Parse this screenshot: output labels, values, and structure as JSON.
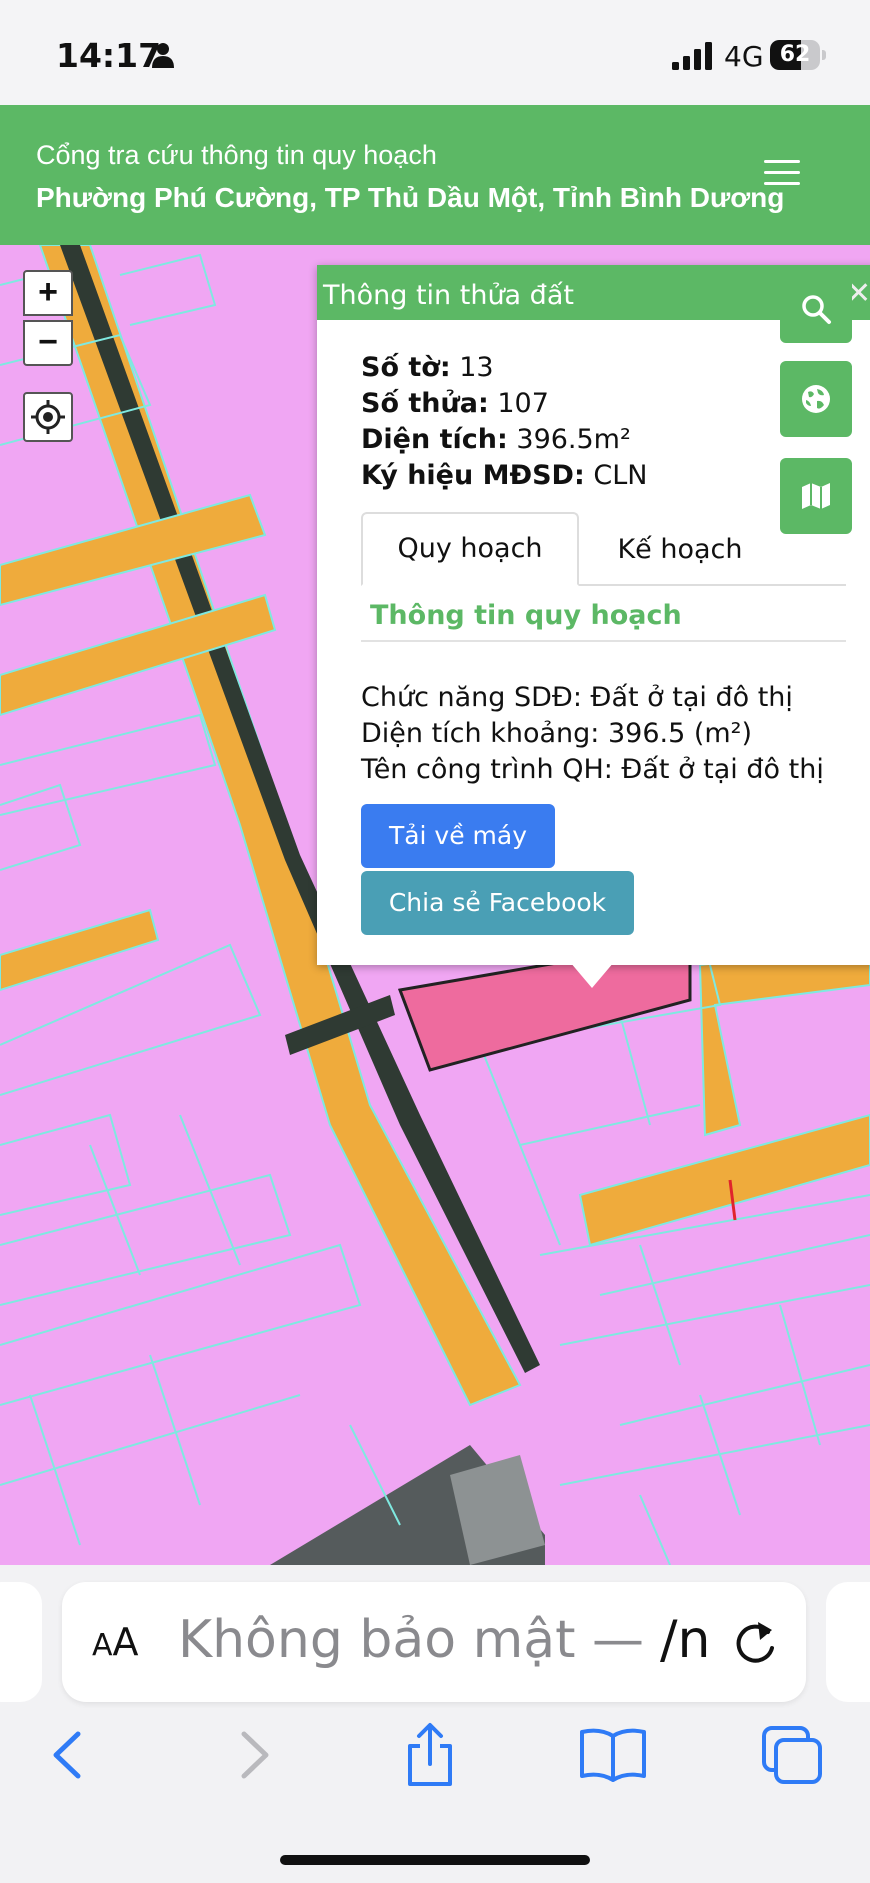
{
  "status_bar": {
    "time": "14:17",
    "network": "4G",
    "battery": "62",
    "battery_level": 0.62
  },
  "header": {
    "subtitle": "Cổng tra cứu thông tin quy hoạch",
    "title": "Phường Phú Cường, TP Thủ Dầu Một, Tỉnh Bình Dương"
  },
  "map_controls": {
    "zoom_in": "+",
    "zoom_out": "−"
  },
  "popup": {
    "title": "Thông tin thửa đất",
    "close": "✕",
    "so_to_label": "Số tờ:",
    "so_to_value": "13",
    "so_thua_label": "Số thửa:",
    "so_thua_value": "107",
    "dien_tich_label": "Diện tích:",
    "dien_tich_value": "396.5m²",
    "ky_hieu_label": "Ký hiệu MĐSD:",
    "ky_hieu_value": "CLN",
    "tabs": [
      {
        "label": "Quy hoạch",
        "active": true
      },
      {
        "label": "Kế hoạch",
        "active": false
      }
    ],
    "section_title": "Thông tin quy hoạch",
    "details": [
      "Chức năng SDĐ: Đất ở tại đô thị",
      "Diện tích khoảng: 396.5 (m²)",
      "Tên công trình QH: Đất ở tại đô thị"
    ],
    "download_button": "Tải về máy",
    "share_button": "Chia sẻ Facebook"
  },
  "side_buttons": {
    "search": "search-icon",
    "globe": "globe-icon",
    "map": "map-icon"
  },
  "browser": {
    "aa_big": "A",
    "aa_small": "A",
    "url": "Không bảo mật — ",
    "url_tail": "/n"
  },
  "colors": {
    "brand_green": "#5cb865",
    "map_pink": "#f0a6f3",
    "road_orange": "#efab3c",
    "parcel_outline": "#7fe9e0",
    "selected_parcel": "#ee6b9e",
    "button_blue": "#3a7cf0",
    "button_teal": "#4a9fb5"
  }
}
